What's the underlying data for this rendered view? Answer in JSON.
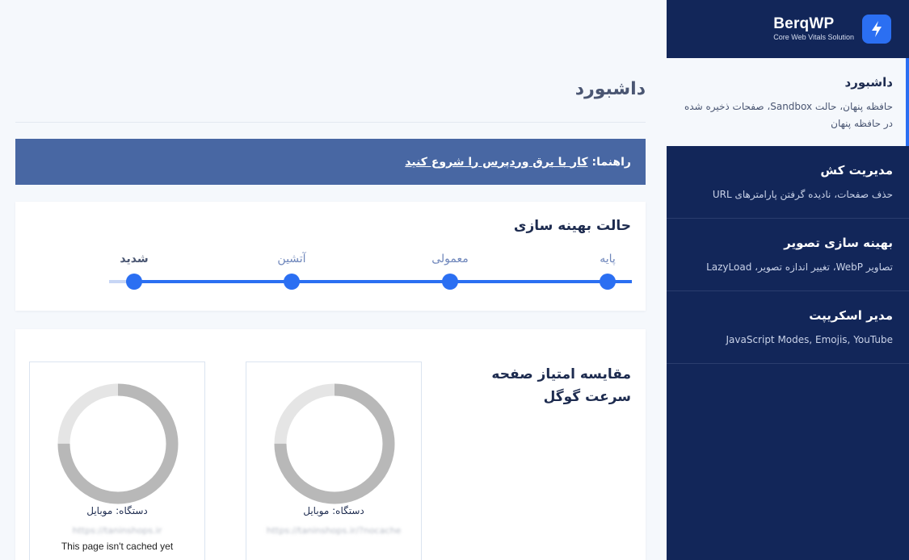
{
  "brand": {
    "name": "BerqWP",
    "tagline": "Core Web Vitals Solution",
    "logo_icon": "lightning-bolt-icon"
  },
  "sidebar": {
    "items": [
      {
        "title": "داشبورد",
        "desc": "حافظه پنهان، حالت Sandbox، صفحات ذخیره شده در حافظه پنهان",
        "active": true
      },
      {
        "title": "مدیریت کش",
        "desc": "حذف صفحات، نادیده گرفتن پارامترهای URL"
      },
      {
        "title": "بهینه سازی تصویر",
        "desc": "تصاویر WebP، تغییر اندازه تصویر، LazyLoad"
      },
      {
        "title": "مدیر اسکریپت",
        "desc": "JavaScript Modes, Emojis, YouTube"
      }
    ]
  },
  "main": {
    "title": "داشبورد",
    "guide": {
      "label": "راهنما:",
      "link": "کار با برق وردپرس را شروع کنید"
    },
    "optimization": {
      "title": "حالت بهینه سازی",
      "levels": [
        "پایه",
        "معمولی",
        "آتشین",
        "شدید"
      ],
      "selected": "شدید"
    },
    "speed": {
      "title": "مقایسه امتیاز صفحه سرعت گوگل",
      "boxes": [
        {
          "device": "دستگاه: موبایل",
          "url": "https://taninshops.ir/?nocache",
          "note": ""
        },
        {
          "device": "دستگاه: موبایل",
          "url": "https://taninshops.ir",
          "note": "This page isn't cached yet"
        }
      ]
    }
  },
  "colors": {
    "sidebar_bg": "#122659",
    "accent": "#2b6ff2",
    "guide_bg": "#4867a3",
    "ring_track": "#e5e5e5",
    "ring_fill": "#b8b8b8"
  }
}
